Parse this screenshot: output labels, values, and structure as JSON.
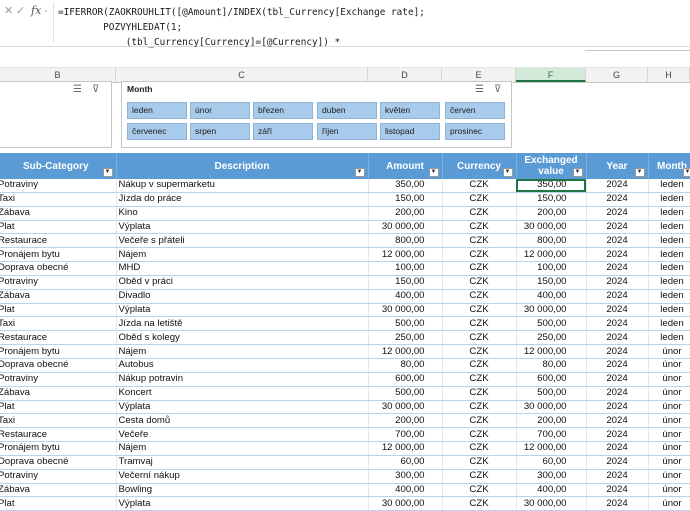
{
  "formula_bar": {
    "icons": {
      "cancel": "✕",
      "enter": "✓",
      "fx": "fx"
    },
    "line1": "=IFERROR(ZAOKROUHLIT([@Amount]/INDEX(tbl_Currency[Exchange rate];",
    "line2": "        POZVYHLEDAT(1;",
    "line3": "            (tbl_Currency[Currency]=[@Currency]) *"
  },
  "columns": [
    "B",
    "C",
    "D",
    "E",
    "F",
    "G",
    "H"
  ],
  "slicer": {
    "title": "Month",
    "buttons": [
      "leden",
      "únor",
      "březen",
      "duben",
      "květen",
      "červen",
      "červenec",
      "srpen",
      "září",
      "říjen",
      "listopad",
      "prosinec"
    ]
  },
  "table": {
    "headers": [
      "Sub-Category",
      "Description",
      "Amount",
      "Currency",
      "Exchanged value",
      "Year",
      "Month"
    ],
    "rows": [
      [
        "Potraviny",
        "Nákup v supermarketu",
        "350,00",
        "CZK",
        "350,00",
        "2024",
        "leden"
      ],
      [
        "Taxi",
        "Jízda do práce",
        "150,00",
        "CZK",
        "150,00",
        "2024",
        "leden"
      ],
      [
        "Zábava",
        "Kino",
        "200,00",
        "CZK",
        "200,00",
        "2024",
        "leden"
      ],
      [
        "Plat",
        "Výplata",
        "30 000,00",
        "CZK",
        "30 000,00",
        "2024",
        "leden"
      ],
      [
        "Restaurace",
        "Večeře s přáteli",
        "800,00",
        "CZK",
        "800,00",
        "2024",
        "leden"
      ],
      [
        "Pronájem bytu",
        "Nájem",
        "12 000,00",
        "CZK",
        "12 000,00",
        "2024",
        "leden"
      ],
      [
        "Doprava obecné",
        "MHD",
        "100,00",
        "CZK",
        "100,00",
        "2024",
        "leden"
      ],
      [
        "Potraviny",
        "Oběd v práci",
        "150,00",
        "CZK",
        "150,00",
        "2024",
        "leden"
      ],
      [
        "Zábava",
        "Divadlo",
        "400,00",
        "CZK",
        "400,00",
        "2024",
        "leden"
      ],
      [
        "Plat",
        "Výplata",
        "30 000,00",
        "CZK",
        "30 000,00",
        "2024",
        "leden"
      ],
      [
        "Taxi",
        "Jízda na letiště",
        "500,00",
        "CZK",
        "500,00",
        "2024",
        "leden"
      ],
      [
        "Restaurace",
        "Oběd s kolegy",
        "250,00",
        "CZK",
        "250,00",
        "2024",
        "leden"
      ],
      [
        "Pronájem bytu",
        "Nájem",
        "12 000,00",
        "CZK",
        "12 000,00",
        "2024",
        "únor"
      ],
      [
        "Doprava obecné",
        "Autobus",
        "80,00",
        "CZK",
        "80,00",
        "2024",
        "únor"
      ],
      [
        "Potraviny",
        "Nákup potravin",
        "600,00",
        "CZK",
        "600,00",
        "2024",
        "únor"
      ],
      [
        "Zábava",
        "Koncert",
        "500,00",
        "CZK",
        "500,00",
        "2024",
        "únor"
      ],
      [
        "Plat",
        "Výplata",
        "30 000,00",
        "CZK",
        "30 000,00",
        "2024",
        "únor"
      ],
      [
        "Taxi",
        "Cesta domů",
        "200,00",
        "CZK",
        "200,00",
        "2024",
        "únor"
      ],
      [
        "Restaurace",
        "Večeře",
        "700,00",
        "CZK",
        "700,00",
        "2024",
        "únor"
      ],
      [
        "Pronájem bytu",
        "Nájem",
        "12 000,00",
        "CZK",
        "12 000,00",
        "2024",
        "únor"
      ],
      [
        "Doprava obecné",
        "Tramvaj",
        "60,00",
        "CZK",
        "60,00",
        "2024",
        "únor"
      ],
      [
        "Potraviny",
        "Večerní nákup",
        "300,00",
        "CZK",
        "300,00",
        "2024",
        "únor"
      ],
      [
        "Zábava",
        "Bowling",
        "400,00",
        "CZK",
        "400,00",
        "2024",
        "únor"
      ],
      [
        "Plat",
        "Výplata",
        "30 000,00",
        "CZK",
        "30 000,00",
        "2024",
        "únor"
      ]
    ]
  }
}
